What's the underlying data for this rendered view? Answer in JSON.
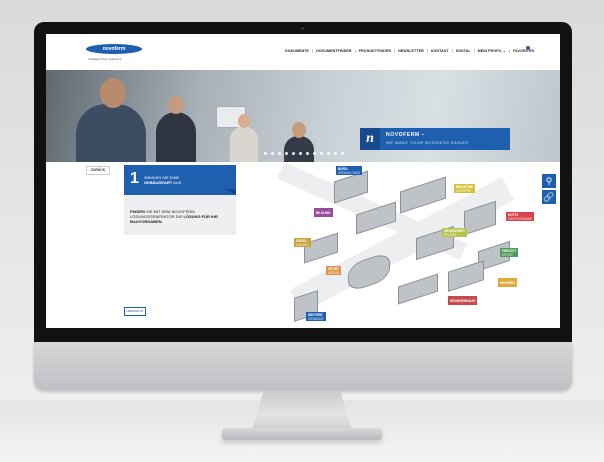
{
  "nav": {
    "logo_text": "novoferm",
    "tagline": "Intelligent Door Solutions",
    "items": [
      "DOKUMENTE",
      "DOKUMENTFINDER",
      "PRODUKTFINDER",
      "NEWSLETTER",
      "KONTAKT",
      "DIGITAL",
      "MEIN PROFIL ⌄",
      "FAVORITEN"
    ]
  },
  "hero": {
    "brand_letter": "n",
    "title": "NOVOFERM –",
    "subtitle": "WE MAKE YOUR BUSINESS EASIER"
  },
  "content": {
    "back_label": "ZURÜCK",
    "step_number": "1",
    "step_text_pre": "WÄHLEN SIE EINE",
    "step_text_bold": "GEBÄUDEART",
    "step_text_post": "AUS.",
    "info_pre": "FINDEN",
    "info_mid": "SIE MIT DEM NOVOFERM LÖSUNGSGENERATOR DIE",
    "info_bold": "LÖSUNG FÜR IHR BAUVORHABEN.",
    "bottom_button": "ÜBERSICHT"
  },
  "tools": {
    "icons": [
      "search-icon",
      "link-icon"
    ],
    "search_glyph": "⚲",
    "link_glyph": "🔗"
  },
  "map_labels": [
    {
      "title": "BÜRO-",
      "sub": "VERWALTUNG",
      "color": "#1f5fb0"
    },
    {
      "title": "INDUSTRIE",
      "sub": "LOGISTIK",
      "color": "#d4c43a"
    },
    {
      "title": "BILDUNG",
      "sub": "",
      "color": "#9c4aa0"
    },
    {
      "title": "HOTEL",
      "sub": "GASTRONOMIE",
      "color": "#d9434a"
    },
    {
      "title": "GESUNDHEIT",
      "sub": "PFLEGE",
      "color": "#b6c44a"
    },
    {
      "title": "FREIZEIT",
      "sub": "SPORT",
      "color": "#4f9a5a"
    },
    {
      "title": "EINZEL-",
      "sub": "HANDEL",
      "color": "#c9a23a"
    },
    {
      "title": "SPORT",
      "sub": "ARENA",
      "color": "#e0934a"
    },
    {
      "title": "WOHNEN",
      "sub": "",
      "color": "#e0a93a"
    },
    {
      "title": "KRANKENHAUS",
      "sub": "",
      "color": "#c94a4a"
    },
    {
      "title": "WEITERE",
      "sub": "GEBÄUDE",
      "color": "#1f5fb0"
    }
  ]
}
